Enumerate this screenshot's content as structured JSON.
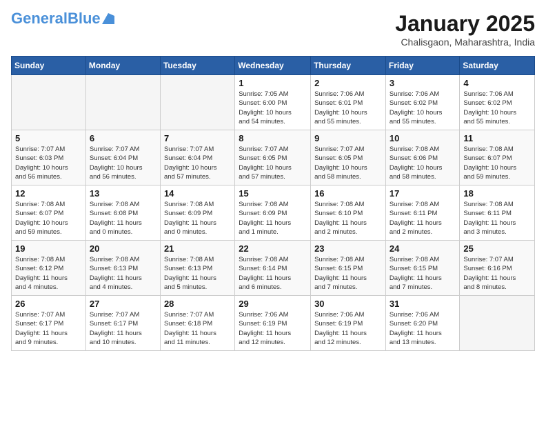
{
  "header": {
    "logo_line1": "General",
    "logo_line2": "Blue",
    "month": "January 2025",
    "location": "Chalisgaon, Maharashtra, India"
  },
  "weekdays": [
    "Sunday",
    "Monday",
    "Tuesday",
    "Wednesday",
    "Thursday",
    "Friday",
    "Saturday"
  ],
  "weeks": [
    [
      {
        "day": "",
        "info": ""
      },
      {
        "day": "",
        "info": ""
      },
      {
        "day": "",
        "info": ""
      },
      {
        "day": "1",
        "info": "Sunrise: 7:05 AM\nSunset: 6:00 PM\nDaylight: 10 hours\nand 54 minutes."
      },
      {
        "day": "2",
        "info": "Sunrise: 7:06 AM\nSunset: 6:01 PM\nDaylight: 10 hours\nand 55 minutes."
      },
      {
        "day": "3",
        "info": "Sunrise: 7:06 AM\nSunset: 6:02 PM\nDaylight: 10 hours\nand 55 minutes."
      },
      {
        "day": "4",
        "info": "Sunrise: 7:06 AM\nSunset: 6:02 PM\nDaylight: 10 hours\nand 55 minutes."
      }
    ],
    [
      {
        "day": "5",
        "info": "Sunrise: 7:07 AM\nSunset: 6:03 PM\nDaylight: 10 hours\nand 56 minutes."
      },
      {
        "day": "6",
        "info": "Sunrise: 7:07 AM\nSunset: 6:04 PM\nDaylight: 10 hours\nand 56 minutes."
      },
      {
        "day": "7",
        "info": "Sunrise: 7:07 AM\nSunset: 6:04 PM\nDaylight: 10 hours\nand 57 minutes."
      },
      {
        "day": "8",
        "info": "Sunrise: 7:07 AM\nSunset: 6:05 PM\nDaylight: 10 hours\nand 57 minutes."
      },
      {
        "day": "9",
        "info": "Sunrise: 7:07 AM\nSunset: 6:05 PM\nDaylight: 10 hours\nand 58 minutes."
      },
      {
        "day": "10",
        "info": "Sunrise: 7:08 AM\nSunset: 6:06 PM\nDaylight: 10 hours\nand 58 minutes."
      },
      {
        "day": "11",
        "info": "Sunrise: 7:08 AM\nSunset: 6:07 PM\nDaylight: 10 hours\nand 59 minutes."
      }
    ],
    [
      {
        "day": "12",
        "info": "Sunrise: 7:08 AM\nSunset: 6:07 PM\nDaylight: 10 hours\nand 59 minutes."
      },
      {
        "day": "13",
        "info": "Sunrise: 7:08 AM\nSunset: 6:08 PM\nDaylight: 11 hours\nand 0 minutes."
      },
      {
        "day": "14",
        "info": "Sunrise: 7:08 AM\nSunset: 6:09 PM\nDaylight: 11 hours\nand 0 minutes."
      },
      {
        "day": "15",
        "info": "Sunrise: 7:08 AM\nSunset: 6:09 PM\nDaylight: 11 hours\nand 1 minute."
      },
      {
        "day": "16",
        "info": "Sunrise: 7:08 AM\nSunset: 6:10 PM\nDaylight: 11 hours\nand 2 minutes."
      },
      {
        "day": "17",
        "info": "Sunrise: 7:08 AM\nSunset: 6:11 PM\nDaylight: 11 hours\nand 2 minutes."
      },
      {
        "day": "18",
        "info": "Sunrise: 7:08 AM\nSunset: 6:11 PM\nDaylight: 11 hours\nand 3 minutes."
      }
    ],
    [
      {
        "day": "19",
        "info": "Sunrise: 7:08 AM\nSunset: 6:12 PM\nDaylight: 11 hours\nand 4 minutes."
      },
      {
        "day": "20",
        "info": "Sunrise: 7:08 AM\nSunset: 6:13 PM\nDaylight: 11 hours\nand 4 minutes."
      },
      {
        "day": "21",
        "info": "Sunrise: 7:08 AM\nSunset: 6:13 PM\nDaylight: 11 hours\nand 5 minutes."
      },
      {
        "day": "22",
        "info": "Sunrise: 7:08 AM\nSunset: 6:14 PM\nDaylight: 11 hours\nand 6 minutes."
      },
      {
        "day": "23",
        "info": "Sunrise: 7:08 AM\nSunset: 6:15 PM\nDaylight: 11 hours\nand 7 minutes."
      },
      {
        "day": "24",
        "info": "Sunrise: 7:08 AM\nSunset: 6:15 PM\nDaylight: 11 hours\nand 7 minutes."
      },
      {
        "day": "25",
        "info": "Sunrise: 7:07 AM\nSunset: 6:16 PM\nDaylight: 11 hours\nand 8 minutes."
      }
    ],
    [
      {
        "day": "26",
        "info": "Sunrise: 7:07 AM\nSunset: 6:17 PM\nDaylight: 11 hours\nand 9 minutes."
      },
      {
        "day": "27",
        "info": "Sunrise: 7:07 AM\nSunset: 6:17 PM\nDaylight: 11 hours\nand 10 minutes."
      },
      {
        "day": "28",
        "info": "Sunrise: 7:07 AM\nSunset: 6:18 PM\nDaylight: 11 hours\nand 11 minutes."
      },
      {
        "day": "29",
        "info": "Sunrise: 7:06 AM\nSunset: 6:19 PM\nDaylight: 11 hours\nand 12 minutes."
      },
      {
        "day": "30",
        "info": "Sunrise: 7:06 AM\nSunset: 6:19 PM\nDaylight: 11 hours\nand 12 minutes."
      },
      {
        "day": "31",
        "info": "Sunrise: 7:06 AM\nSunset: 6:20 PM\nDaylight: 11 hours\nand 13 minutes."
      },
      {
        "day": "",
        "info": ""
      }
    ]
  ]
}
